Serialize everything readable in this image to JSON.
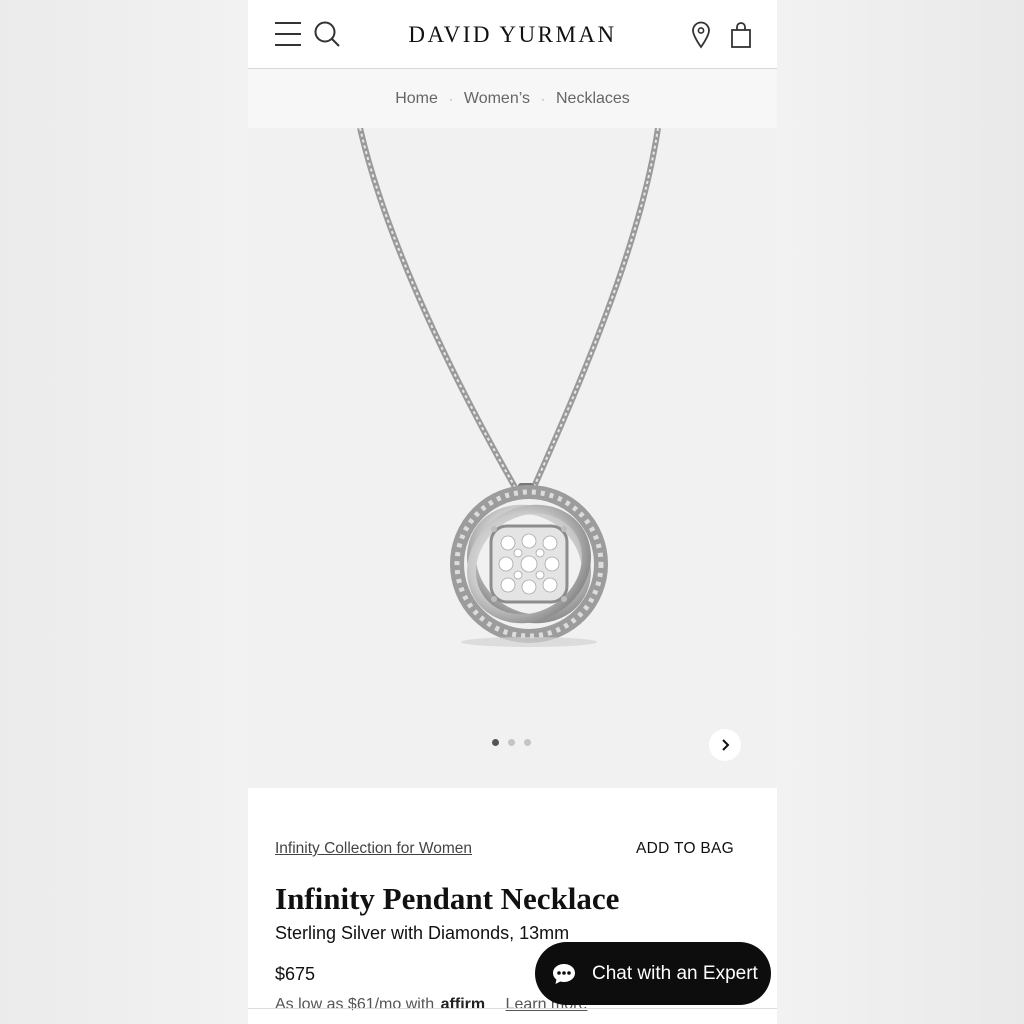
{
  "header": {
    "brand": "DAVID YURMAN"
  },
  "breadcrumb": {
    "items": [
      "Home",
      "Women’s",
      "Necklaces"
    ],
    "separator": "·"
  },
  "gallery": {
    "image_count": 3,
    "active_index": 0
  },
  "product": {
    "collection_link": "Infinity Collection for Women",
    "add_to_bag": "ADD TO BAG",
    "title": "Infinity Pendant Necklace",
    "subtitle": "Sterling Silver with Diamonds, 13mm",
    "price": "$675",
    "financing_prefix": "As low as $61/mo with",
    "financing_provider": "affirm",
    "financing_link": "Learn more"
  },
  "chat": {
    "label": "Chat with an Expert"
  },
  "icons": [
    "menu-icon",
    "search-icon",
    "location-pin-icon",
    "shopping-bag-icon",
    "chevron-right-icon",
    "chat-bubble-icon"
  ],
  "colors": {
    "chat_bg": "#0d0d0d",
    "page_bg": "#ffffff",
    "gallery_bg": "#f1f1f1"
  }
}
